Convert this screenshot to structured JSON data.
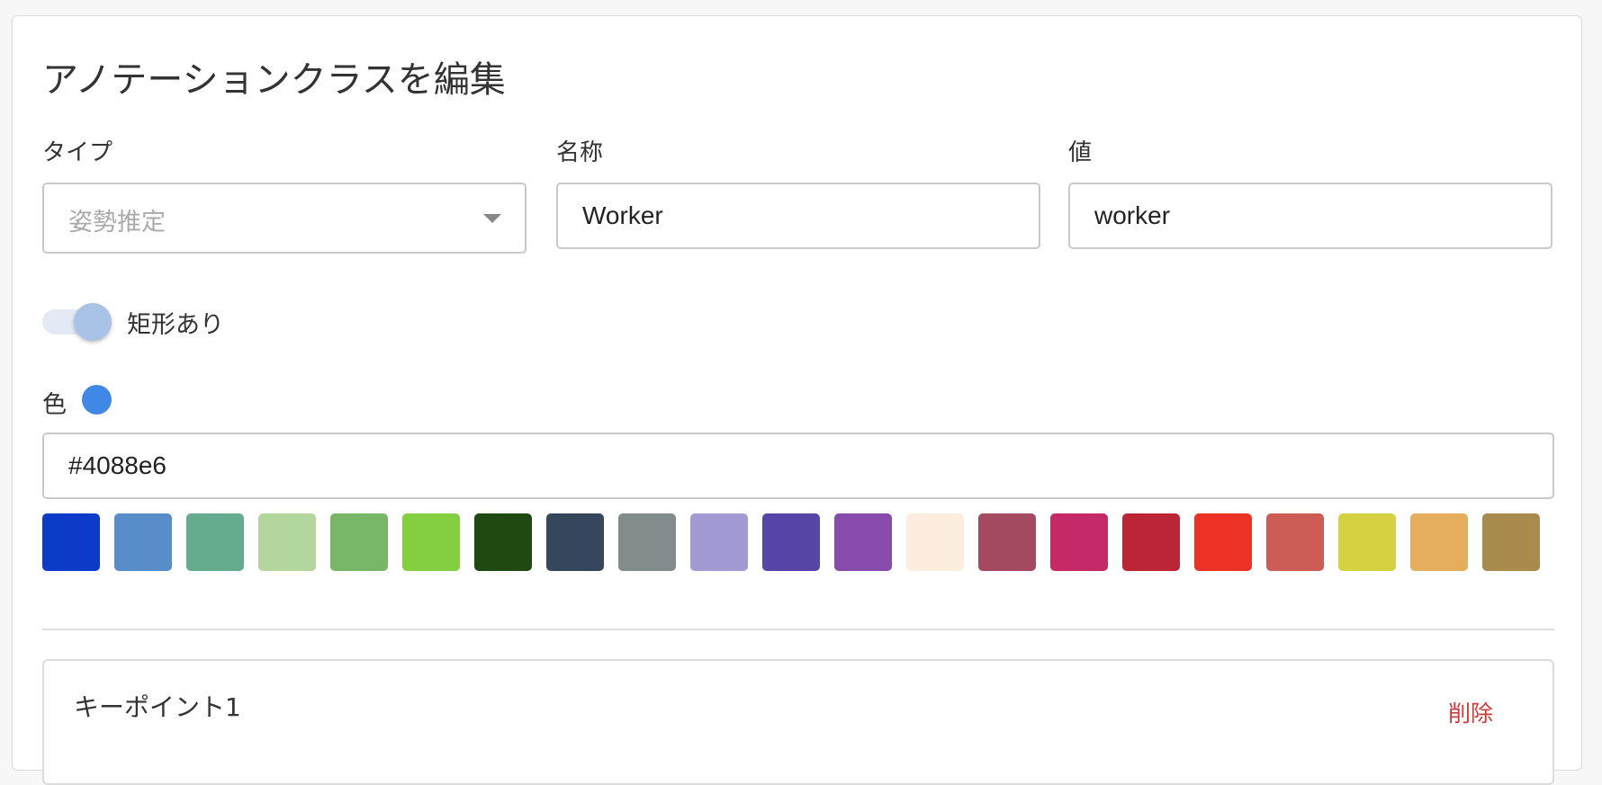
{
  "dialog": {
    "title": "アノテーションクラスを編集"
  },
  "fields": {
    "type": {
      "label": "タイプ",
      "value": "姿勢推定"
    },
    "name": {
      "label": "名称",
      "value": "Worker"
    },
    "value": {
      "label": "値",
      "value": "worker"
    }
  },
  "bbox_toggle": {
    "label": "矩形あり",
    "on": true
  },
  "color": {
    "label": "色",
    "current": "#4088e6",
    "hex_value": "#4088e6",
    "swatches": [
      "#0c3bc9",
      "#578ec9",
      "#65ac8f",
      "#b3d69d",
      "#77b767",
      "#84cf40",
      "#1e4a12",
      "#36475d",
      "#828c8c",
      "#a19ad3",
      "#5746a7",
      "#864bab",
      "#fdeddf",
      "#a34a61",
      "#c52966",
      "#bb2536",
      "#ec3224",
      "#cd5c55",
      "#d4d241",
      "#e5ae5d",
      "#a98b4e"
    ]
  },
  "keypoint": {
    "title": "キーポイント1",
    "delete_label": "削除"
  }
}
